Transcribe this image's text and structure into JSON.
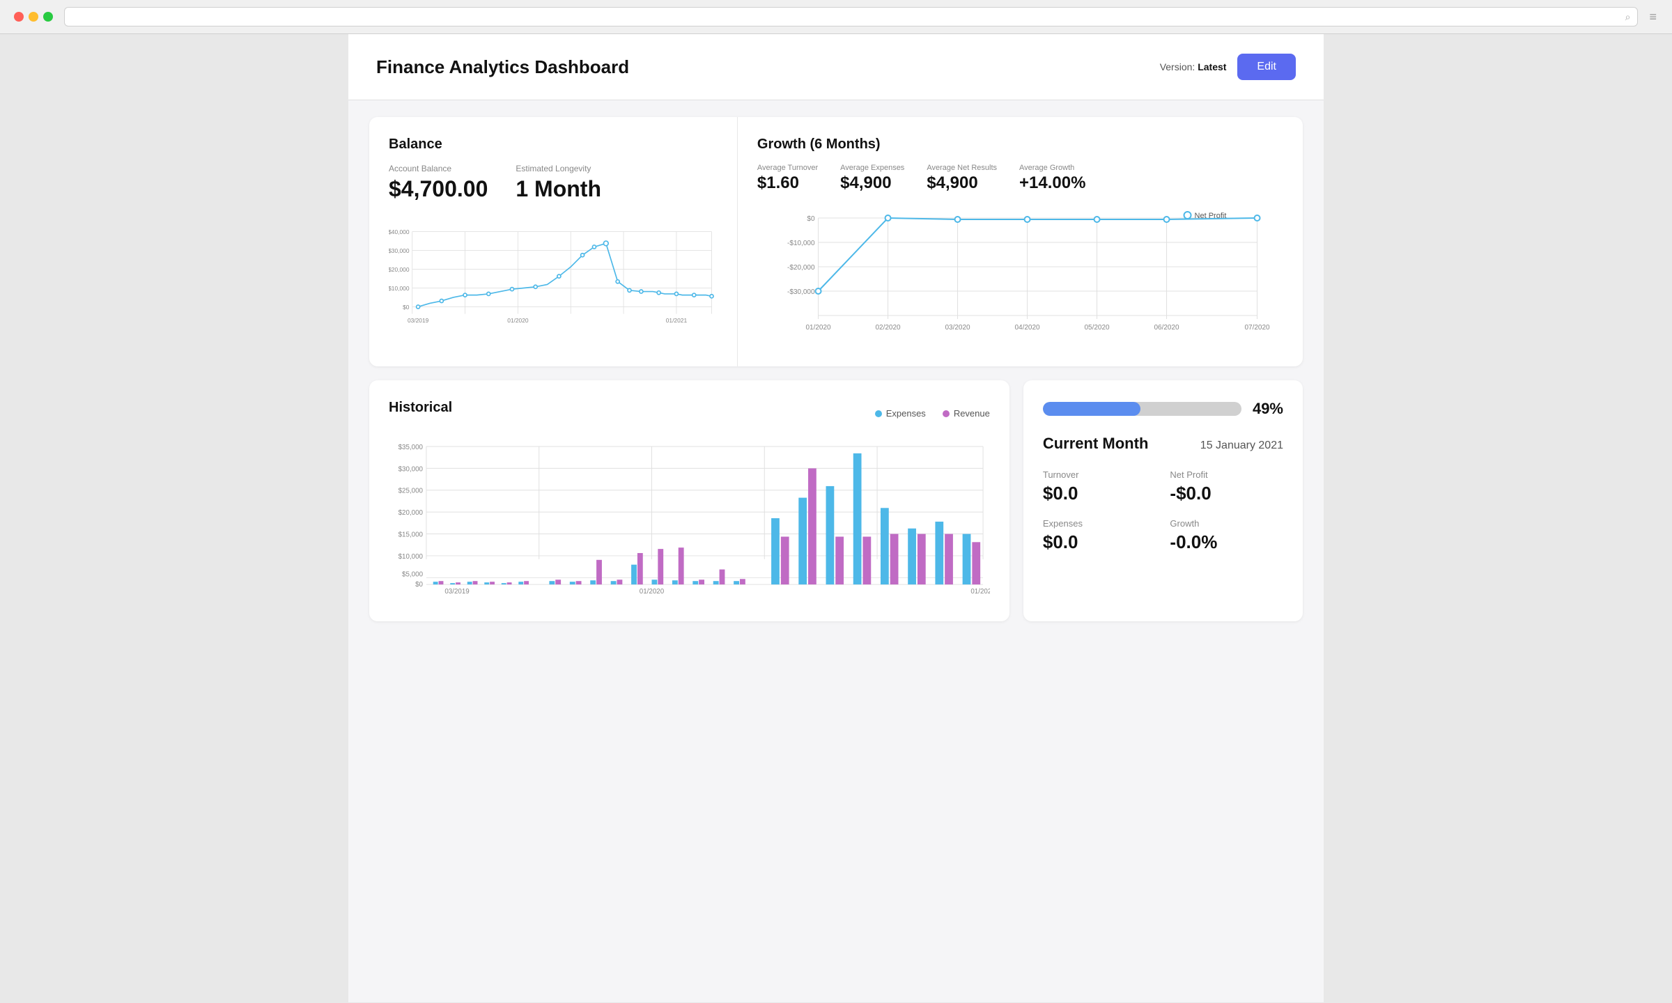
{
  "browser": {
    "traffic_lights": [
      "red",
      "yellow",
      "green"
    ]
  },
  "header": {
    "title": "Finance Analytics Dashboard",
    "version_label": "Version:",
    "version_value": "Latest",
    "edit_button": "Edit"
  },
  "balance": {
    "section_title": "Balance",
    "account_balance_label": "Account Balance",
    "account_balance_value": "$4,700.00",
    "estimated_longevity_label": "Estimated Longevity",
    "estimated_longevity_value": "1 Month"
  },
  "growth": {
    "section_title": "Growth (6 Months)",
    "avg_turnover_label": "Average Turnover",
    "avg_turnover_value": "$1.60",
    "avg_expenses_label": "Average Expenses",
    "avg_expenses_value": "$4,900",
    "avg_net_results_label": "Average Net Results",
    "avg_net_results_value": "$4,900",
    "avg_growth_label": "Average Growth",
    "avg_growth_value": "+14.00%",
    "net_profit_label": "Net Profit"
  },
  "historical": {
    "section_title": "Historical",
    "legend_expenses": "Expenses",
    "legend_revenue": "Revenue"
  },
  "stats": {
    "progress_pct": "49%",
    "current_month_label": "Current Month",
    "current_month_date": "15 January 2021",
    "turnover_label": "Turnover",
    "turnover_value": "$0.0",
    "net_profit_label": "Net Profit",
    "net_profit_value": "-$0.0",
    "expenses_label": "Expenses",
    "expenses_value": "$0.0",
    "growth_label": "Growth",
    "growth_value": "-0.0%"
  },
  "colors": {
    "accent": "#5b6af0",
    "blue_line": "#4db8e8",
    "purple_bar": "#c06bc4",
    "blue_bar": "#4db8e8"
  }
}
